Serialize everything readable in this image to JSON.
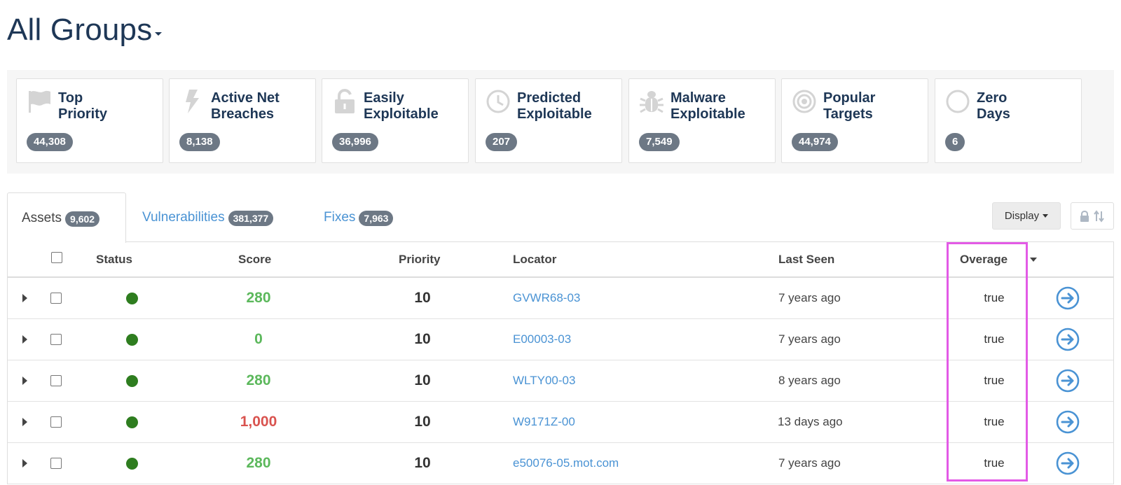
{
  "page": {
    "title": "All Groups"
  },
  "cards": [
    {
      "icon": "flag-icon",
      "label": "Top\nPriority",
      "count": "44,308"
    },
    {
      "icon": "lightning-icon",
      "label": "Active Net\nBreaches",
      "count": "8,138"
    },
    {
      "icon": "unlock-icon",
      "label": "Easily\nExploitable",
      "count": "36,996"
    },
    {
      "icon": "clock-icon",
      "label": "Predicted\nExploitable",
      "count": "207"
    },
    {
      "icon": "bug-icon",
      "label": "Malware\nExploitable",
      "count": "7,549"
    },
    {
      "icon": "target-icon",
      "label": "Popular\nTargets",
      "count": "44,974"
    },
    {
      "icon": "circle-icon",
      "label": "Zero\nDays",
      "count": "6"
    }
  ],
  "tabs": [
    {
      "label": "Assets",
      "count": "9,602"
    },
    {
      "label": "Vulnerabilities",
      "count": "381,377"
    },
    {
      "label": "Fixes",
      "count": "7,963"
    }
  ],
  "toolbar": {
    "display_label": "Display"
  },
  "table": {
    "headers": {
      "status": "Status",
      "score": "Score",
      "priority": "Priority",
      "locator": "Locator",
      "last_seen": "Last Seen",
      "overage": "Overage"
    },
    "rows": [
      {
        "score": "280",
        "score_color": "#5cb85c",
        "priority": "10",
        "locator": "GVWR68-03",
        "last_seen": "7 years ago",
        "overage": "true"
      },
      {
        "score": "0",
        "score_color": "#5cb85c",
        "priority": "10",
        "locator": "E00003-03",
        "last_seen": "7 years ago",
        "overage": "true"
      },
      {
        "score": "280",
        "score_color": "#5cb85c",
        "priority": "10",
        "locator": "WLTY00-03",
        "last_seen": "8 years ago",
        "overage": "true"
      },
      {
        "score": "1,000",
        "score_color": "#d9534f",
        "priority": "10",
        "locator": "W9171Z-00",
        "last_seen": "13 days ago",
        "overage": "true"
      },
      {
        "score": "280",
        "score_color": "#5cb85c",
        "priority": "10",
        "locator": "e50076-05.mot.com",
        "last_seen": "7 years ago",
        "overage": "true"
      }
    ]
  },
  "colors": {
    "title": "#1e3756",
    "link": "#4a93d4",
    "badge": "#6d7885",
    "status_ok": "#2e7d1f",
    "highlight": "#e35ae6"
  }
}
